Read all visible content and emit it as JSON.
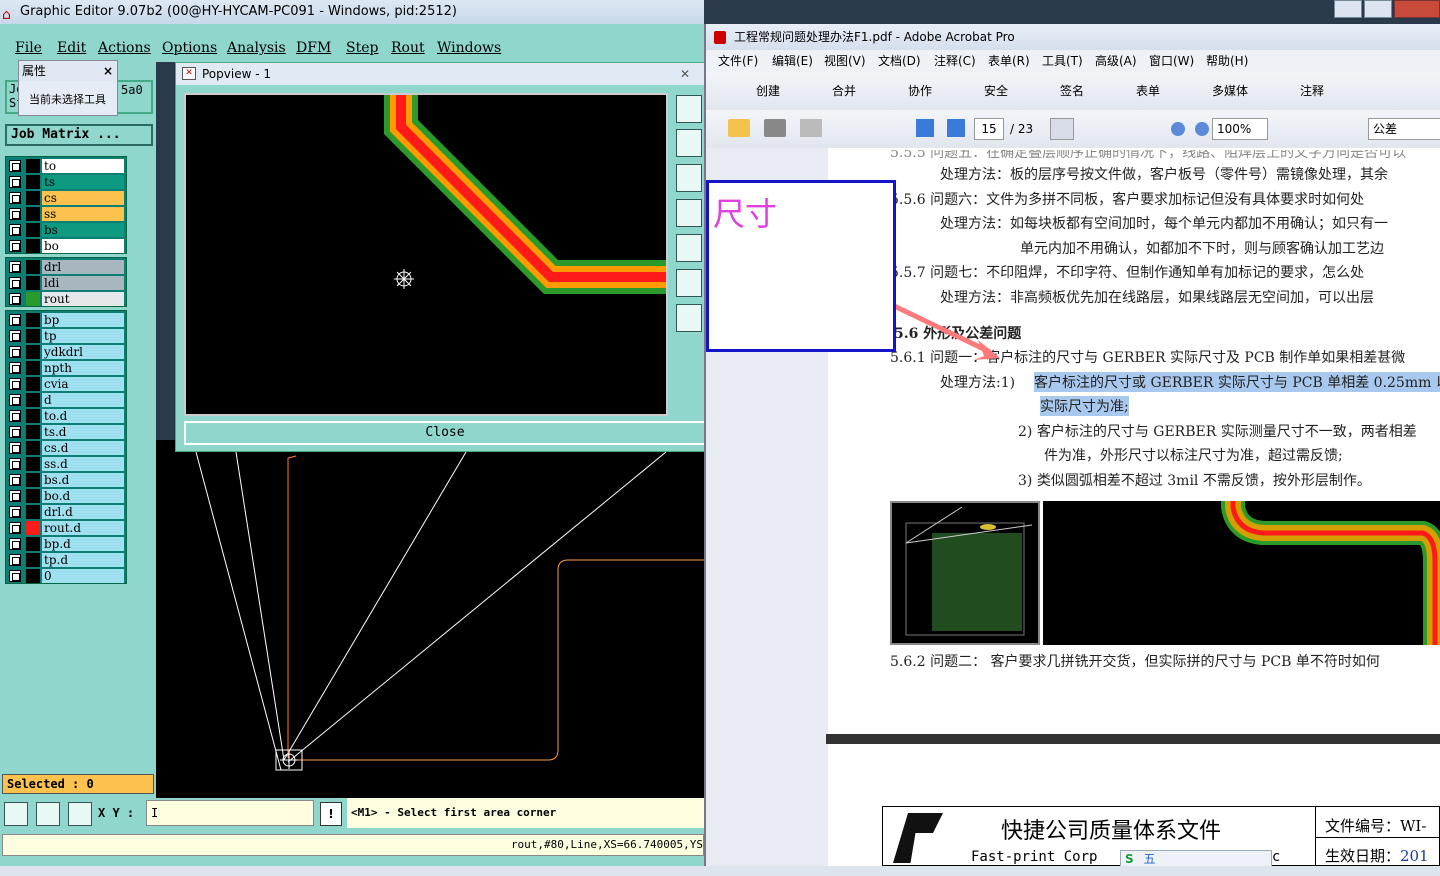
{
  "genesis": {
    "title": "Graphic Editor 9.07b2 (00@HY-HYCAM-PC091 - Windows, pid:2512)",
    "menus": [
      "File",
      "Edit",
      "Actions",
      "Options",
      "Analysis",
      "DFM",
      "Step",
      "Rout",
      "Windows"
    ],
    "job_fragment_top": "Jo",
    "job_fragment_id": "5a0",
    "step_fragment": "St",
    "job_matrix_label": "Job Matrix ...",
    "layers_group1": [
      {
        "name": "to",
        "color": "#ffffff"
      },
      {
        "name": "ts",
        "color": "#0e9a80"
      },
      {
        "name": "cs",
        "color": "#fbc24e"
      },
      {
        "name": "ss",
        "color": "#fbc24e"
      },
      {
        "name": "bs",
        "color": "#0e9a80"
      },
      {
        "name": "bo",
        "color": "#ffffff"
      }
    ],
    "layers_group2": [
      {
        "name": "drl",
        "color": "#a8b6bf"
      },
      {
        "name": "ldi",
        "color": "#a8b6bf"
      },
      {
        "name": "rout",
        "color": "#e4e8ea",
        "mark": "#2a9a2a"
      }
    ],
    "layers_group3": [
      {
        "name": "bp",
        "color": "#9fe0f0"
      },
      {
        "name": "tp",
        "color": "#9fe0f0"
      },
      {
        "name": "ydkdrl",
        "color": "#9fe0f0"
      },
      {
        "name": "npth",
        "color": "#9fe0f0"
      },
      {
        "name": "cvia",
        "color": "#9fe0f0"
      },
      {
        "name": "d",
        "color": "#9fe0f0"
      },
      {
        "name": "to.d",
        "color": "#9fe0f0"
      },
      {
        "name": "ts.d",
        "color": "#9fe0f0"
      },
      {
        "name": "cs.d",
        "color": "#9fe0f0"
      },
      {
        "name": "ss.d",
        "color": "#9fe0f0"
      },
      {
        "name": "bs.d",
        "color": "#9fe0f0"
      },
      {
        "name": "bo.d",
        "color": "#9fe0f0"
      },
      {
        "name": "drl.d",
        "color": "#9fe0f0"
      },
      {
        "name": "rout.d",
        "color": "#9fe0f0",
        "mark": "#ff1a1a"
      },
      {
        "name": "bp.d",
        "color": "#9fe0f0"
      },
      {
        "name": "tp.d",
        "color": "#9fe0f0"
      },
      {
        "name": "0",
        "color": "#9fe0f0"
      }
    ],
    "selected_label": "Selected : 0",
    "xy_label": "X Y :",
    "xy_value": "I",
    "prompt_icon": "!",
    "prompt_text": "<M1> - Select first area corner",
    "status_text": "rout,#80,Line,XS=66.740005,YS"
  },
  "props_window": {
    "title": "属性",
    "close": "×",
    "text": "当前未选择工具"
  },
  "popview": {
    "title": "Popview - 1",
    "close_label": "Close",
    "x_icon": "✕"
  },
  "acrobat": {
    "title": "工程常规问题处理办法F1.pdf - Adobe Acrobat Pro",
    "menus": [
      "文件(F)",
      "编辑(E)",
      "视图(V)",
      "文档(D)",
      "注释(C)",
      "表单(R)",
      "工具(T)",
      "高级(A)",
      "窗口(W)",
      "帮助(H)"
    ],
    "toolbar1": [
      "创建",
      "合并",
      "协作",
      "安全",
      "签名",
      "表单",
      "多媒体",
      "注释"
    ],
    "page_current": "15",
    "page_total": "/ 23",
    "zoom": "100%",
    "search": "公差",
    "annotation_text": "尺寸",
    "doc_lines": [
      "5.5.5 问题五：在确定叠层顺序正确的情况下，线路、阻焊层上的文字方向是否可以",
      "处理方法：板的层序号按文件做，客户板号（零件号）需镜像处理，其余",
      "5.5.6 问题六：文件为多拼不同板，客户要求加标记但没有具体要求时如何处",
      "处理方法：如每块板都有空间加时，每个单元内都加不用确认；如只有一",
      "单元内加不用确认，如都加不下时，则与顾客确认加工艺边",
      "5.5.7 问题七：不印阻焊，不印字符、但制作通知单有加标记的要求，怎么处",
      "处理方法：非高频板优先加在线路层，如果线路层无空间加，可以出层",
      "5.6 外形及公差问题",
      "5.6.1 问题一：客户标注的尺寸与 GERBER 实际尺寸及 PCB 制作单如果相差甚微",
      "处理方法:1)",
      "客户标注的尺寸或 GERBER 实际尺寸与 PCB 单相差 0.25mm 以",
      "实际尺寸为准;",
      "2) 客户标注的尺寸与 GERBER 实际测量尺寸不一致，两者相差",
      "件为准，外形尺寸以标注尺寸为准，超过需反馈;",
      "3) 类似圆弧相差不超过 3mil 不需反馈，按外形层制作。",
      "5.6.2 问题二：  客户要求几拼铣开交货，但实际拼的尺寸与 PCB 单不符时如何"
    ],
    "footer_title": "快捷公司质量体系文件",
    "footer_company": "Fast-print Corp",
    "footer_doc": "Doc",
    "footer_file_no": "文件编号：WI-",
    "footer_date": "生效日期：",
    "footer_date_val": "201",
    "ime_items": [
      "S",
      "五"
    ]
  },
  "colors": {
    "genesis_bg": "#8fd6cc",
    "rout_red": "#ff1a1a",
    "rout_orange": "#ff9a00",
    "rout_green": "#2a9a2a",
    "annotation_blue": "#1414c8",
    "annotation_text": "#e040e0",
    "highlight": "#a8c8ee"
  }
}
